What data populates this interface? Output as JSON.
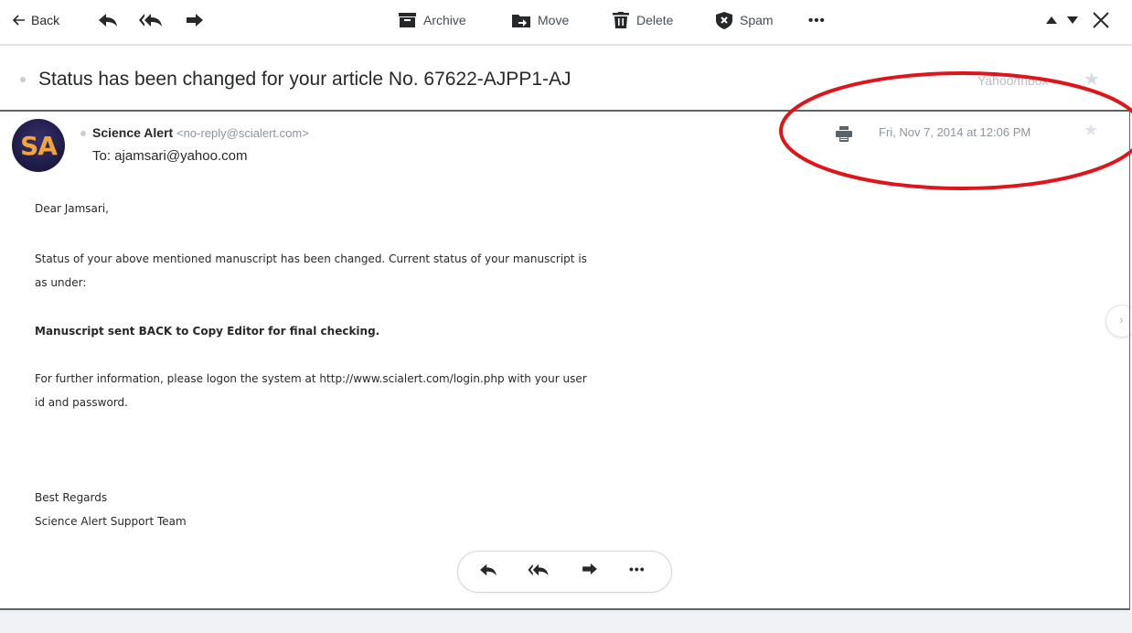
{
  "toolbar": {
    "back_label": "Back",
    "archive_label": "Archive",
    "move_label": "Move",
    "delete_label": "Delete",
    "spam_label": "Spam",
    "more_label": "•••"
  },
  "message": {
    "subject": "Status has been changed for your article No. 67622-AJPP1-AJ",
    "folder": "Yahoo/Inbox",
    "sender_name": "Science Alert",
    "sender_email": "<no-reply@scialert.com>",
    "to": "To: ajamsari@yahoo.com",
    "datetime": "Fri, Nov 7, 2014 at 12:06 PM",
    "avatar_initials": "SA"
  },
  "body": {
    "greeting": "Dear Jamsari,",
    "para1_line1": "Status of your above mentioned manuscript has been changed. Current status of your manuscript is",
    "para1_line2": "as under:",
    "status_line": "Manuscript sent BACK to Copy Editor for final checking.",
    "para2_line1": "For further information, please logon the system at http://www.scialert.com/login.php with your user",
    "para2_line2": "id and password.",
    "closing1": "Best Regards",
    "closing2": "Science Alert Support Team"
  },
  "icons": {
    "back": "arrow-left-icon",
    "reply": "reply-icon",
    "reply_all": "reply-all-icon",
    "forward": "forward-icon",
    "archive": "archive-icon",
    "move": "move-icon",
    "delete": "trash-icon",
    "spam": "shield-icon",
    "prev": "caret-up-icon",
    "next": "caret-down-icon",
    "close": "close-icon",
    "print": "print-icon",
    "star": "star-icon"
  },
  "colors": {
    "text": "#26282a",
    "muted": "#8d949c",
    "annotation": "#e0141b",
    "avatar_text": "#f2a33a"
  }
}
